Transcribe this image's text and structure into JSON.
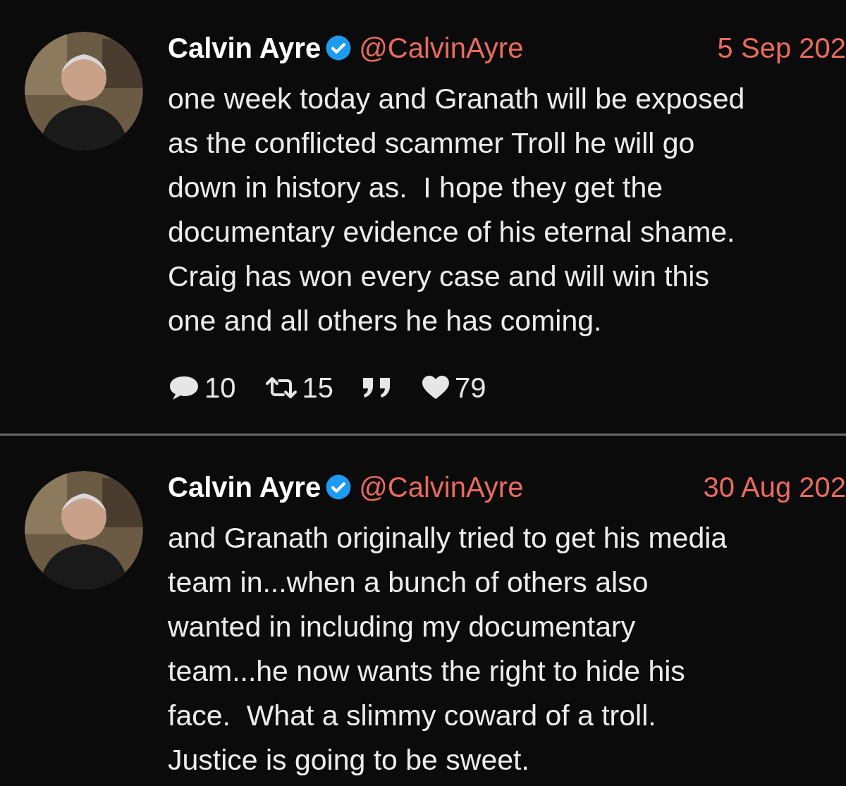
{
  "tweets": [
    {
      "name": "Calvin Ayre",
      "verified": true,
      "handle": "@CalvinAyre",
      "date": "5 Sep 202",
      "text": "one week today and Granath will be exposed\nas the conflicted scammer Troll he will go\ndown in history as.  I hope they get the\ndocumentary evidence of his eternal shame.\nCraig has won every case and will win this\none and all others he has coming.",
      "stats": {
        "replies": "10",
        "retweets": "15",
        "likes": "79"
      }
    },
    {
      "name": "Calvin Ayre",
      "verified": true,
      "handle": "@CalvinAyre",
      "date": "30 Aug 202",
      "text": "and Granath originally tried to get his media\nteam in...when a bunch of others also\nwanted in including my documentary\nteam...he now wants the right to hide his\nface.  What a slimmy coward of a troll.\nJustice is going to be sweet."
    }
  ]
}
